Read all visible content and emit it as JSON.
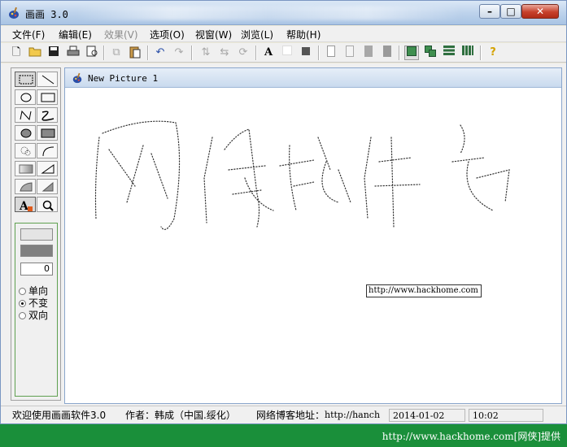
{
  "window": {
    "title": "画画 3.0"
  },
  "menu": [
    {
      "label": "文件(F)",
      "enabled": true
    },
    {
      "label": "编辑(E)",
      "enabled": true
    },
    {
      "label": "效果(V)",
      "enabled": false
    },
    {
      "label": "选项(O)",
      "enabled": true
    },
    {
      "label": "视窗(W)",
      "enabled": true
    },
    {
      "label": "浏览(L)",
      "enabled": true
    },
    {
      "label": "帮助(H)",
      "enabled": true
    }
  ],
  "toolbar": {
    "icons": [
      "new-file-icon",
      "open-folder-icon",
      "save-icon",
      "print-icon",
      "print-preview-icon",
      "copy-icon",
      "paste-icon",
      "undo-icon",
      "redo-icon",
      "flip-vertical-icon",
      "flip-horizontal-icon",
      "rotate-icon",
      "text-icon",
      "white-box-icon",
      "black-box-icon",
      "page-icon",
      "page-outline-icon",
      "gray-page-icon",
      "gray-page-2-icon",
      "layout-single-icon",
      "layout-cascade-icon",
      "layout-rows-icon",
      "layout-columns-icon",
      "help-icon"
    ]
  },
  "tools": [
    "rect-select-icon",
    "line-icon",
    "ellipse-icon",
    "rectangle-icon",
    "polyline-icon",
    "curve-icon",
    "filled-ellipse-icon",
    "filled-rectangle-icon",
    "spray-icon",
    "arc-icon",
    "gradient-rect-icon",
    "triangle-icon",
    "wedge-icon",
    "gradient-fill-icon",
    "text-tool-icon",
    "zoom-icon"
  ],
  "options": {
    "size_value": "0",
    "radios": [
      {
        "label": "单向",
        "checked": false
      },
      {
        "label": "不变",
        "checked": true
      },
      {
        "label": "双向",
        "checked": false
      }
    ]
  },
  "document": {
    "title": "New Picture 1",
    "url_text": "http://www.hackhome.com"
  },
  "status": {
    "welcome": "欢迎使用画画软件3.0",
    "author": "作者：韩成（中国.绥化）",
    "blog_label": "网络博客地址：",
    "blog_url": "http://hanch",
    "date": "2014-01-02",
    "time": "10:02"
  },
  "footer": {
    "text": "http://www.hackhome.com[网侠]提供"
  }
}
